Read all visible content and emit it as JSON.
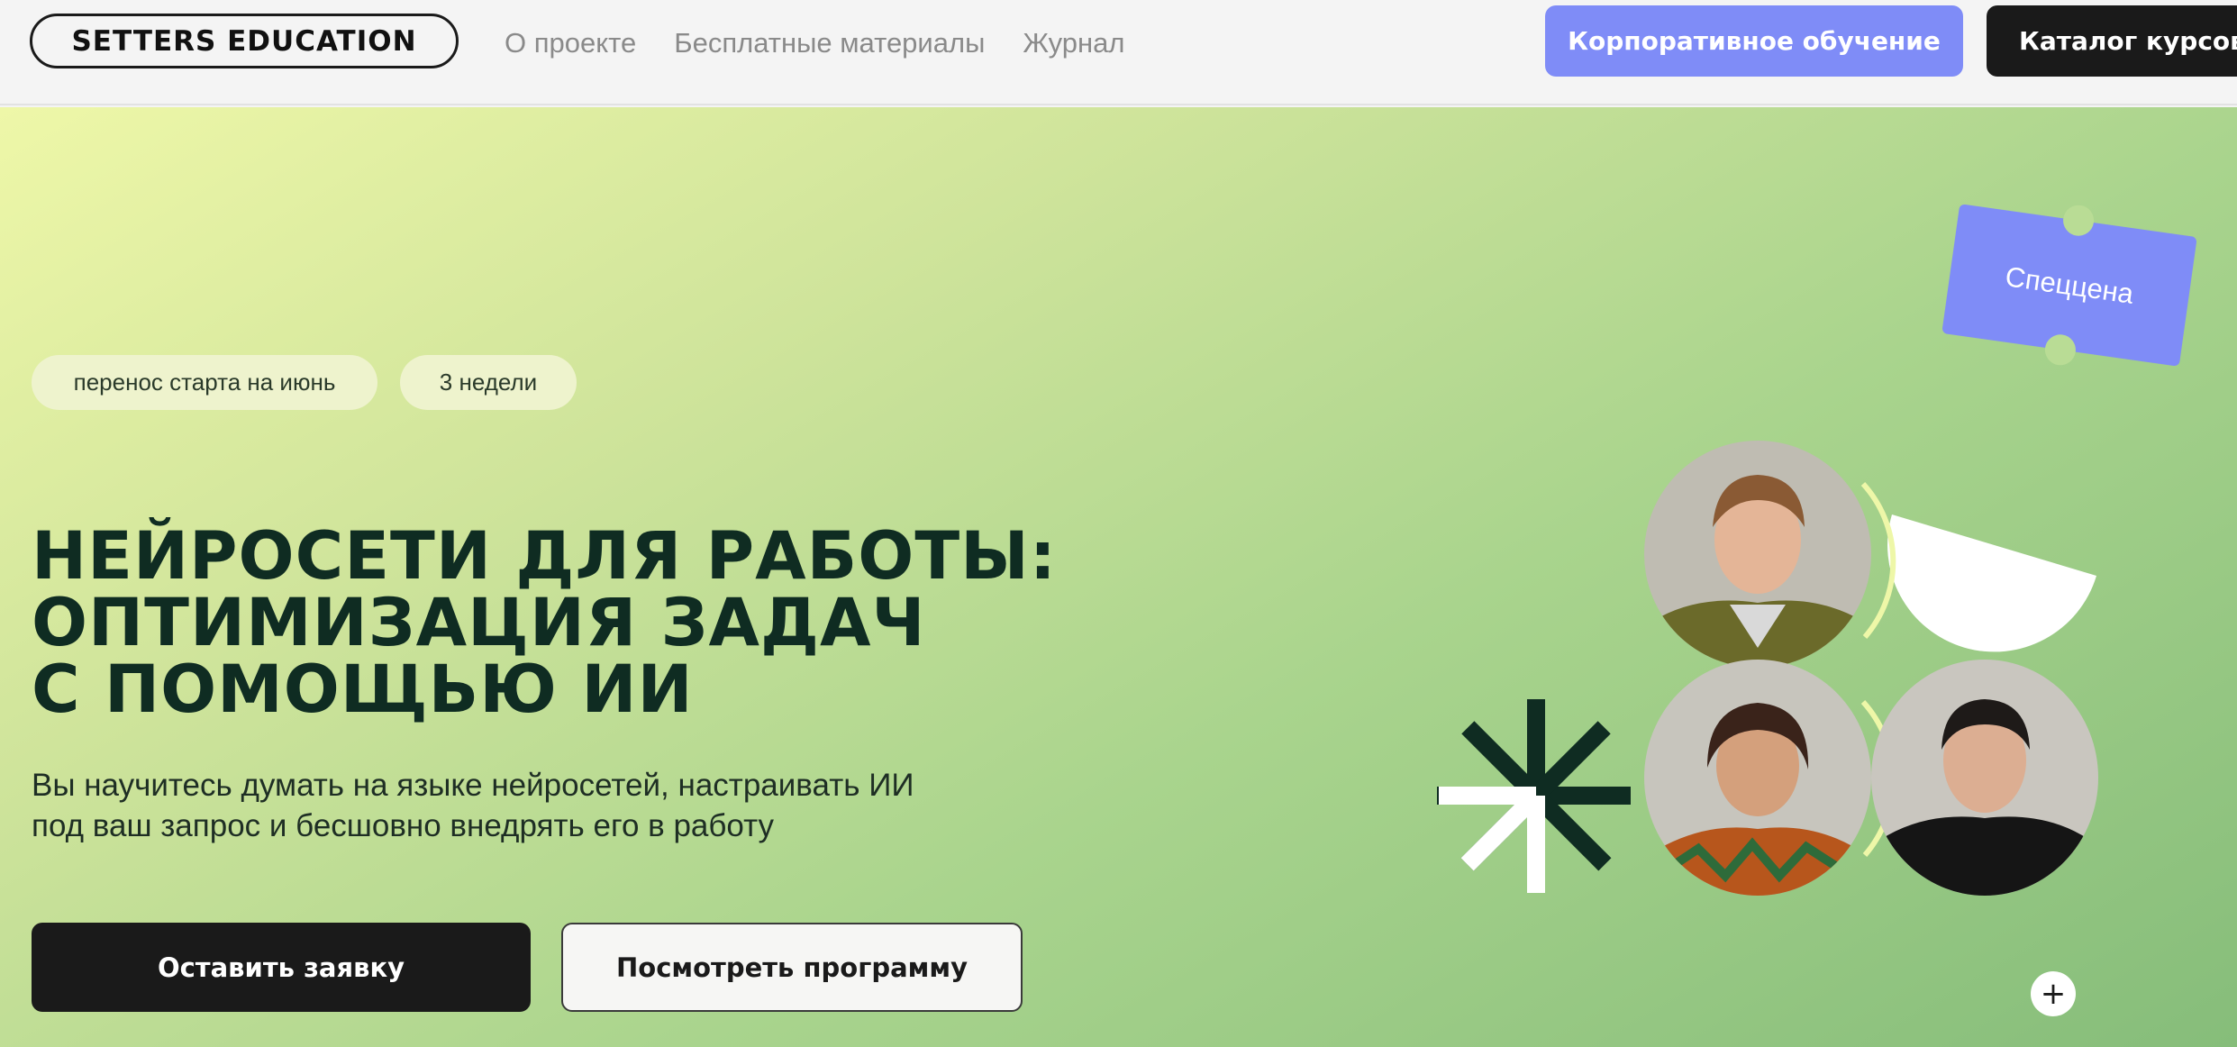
{
  "header": {
    "logo": "SETTERS EDUCATION",
    "nav": [
      {
        "label": "О проекте"
      },
      {
        "label": "Бесплатные материалы"
      },
      {
        "label": "Журнал"
      }
    ],
    "corporate_label": "Корпоративное обучение",
    "catalog_label": "Каталог курсов"
  },
  "hero": {
    "badge": "Спеццена",
    "chips": [
      "перенос старта на июнь",
      "3 недели"
    ],
    "title_lines": [
      "НЕЙРОСЕТИ ДЛЯ РАБОТЫ:",
      "ОПТИМИЗАЦИЯ ЗАДАЧ",
      "С ПОМОЩЬЮ ИИ"
    ],
    "subtitle_lines": [
      "Вы научитесь думать на языке нейросетей, настраивать ИИ",
      "под ваш запрос и бесшовно внедрять его в работу"
    ],
    "apply_label": "Оставить заявку",
    "program_label": "Посмотреть программу",
    "plus": "+"
  },
  "colors": {
    "accent": "#7f8cf7",
    "dark": "#1a1a1a",
    "title": "#0f2c22",
    "chip_bg": "#eef3cd"
  },
  "icons": {
    "asterisk": "asterisk-arrow-icon",
    "plus": "plus-icon"
  }
}
